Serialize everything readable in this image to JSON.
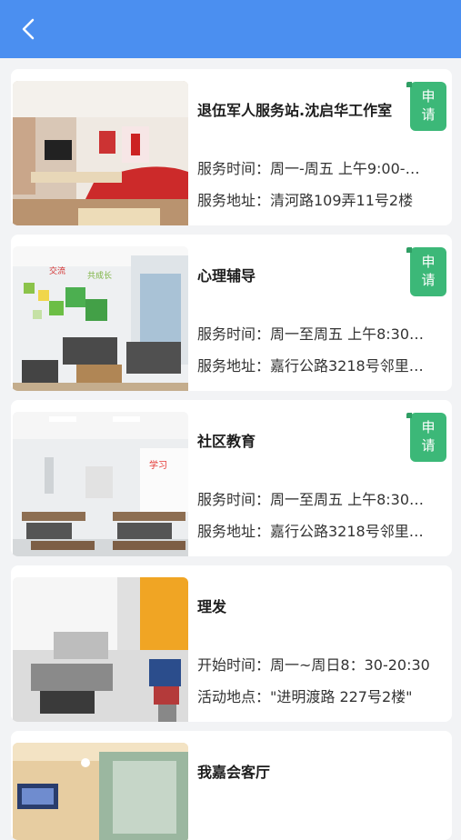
{
  "header": {
    "back_icon": "chevron-left-icon"
  },
  "items": [
    {
      "title": "退伍军人服务站.沈启华工作室",
      "line1": "服务时间：周一-周五 上午9:00-…",
      "line2": "服务地址：清河路109弄11号2楼",
      "apply": [
        "申",
        "请"
      ]
    },
    {
      "title": "心理辅导",
      "line1": "服务时间：周一至周五 上午8:30…",
      "line2": "服务地址：嘉行公路3218号邻里…",
      "apply": [
        "申",
        "请"
      ]
    },
    {
      "title": "社区教育",
      "line1": "服务时间：周一至周五 上午8:30…",
      "line2": "服务地址：嘉行公路3218号邻里…",
      "apply": [
        "申",
        "请"
      ]
    },
    {
      "title": "理发",
      "line1": "开始时间：周一~周日8：30-20:30",
      "line2": "活动地点：\"进明渡路 227号2楼\""
    },
    {
      "title": "我嘉会客厅"
    }
  ],
  "colors": {
    "header": "#4b8ff0",
    "apply": "#3cb878",
    "background": "#f2f3f5"
  }
}
